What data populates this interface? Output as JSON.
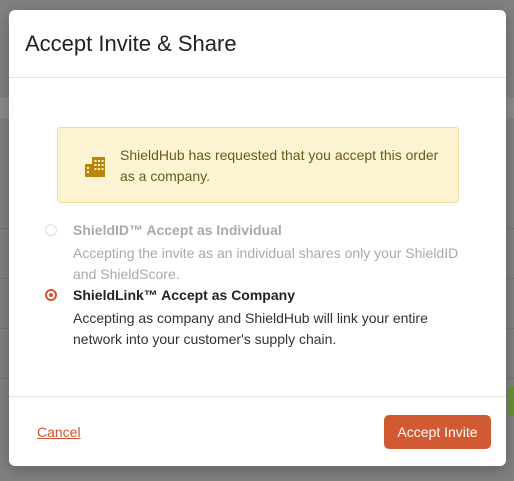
{
  "modal": {
    "title": "Accept Invite & Share",
    "notice": {
      "text": "ShieldHub has requested that you accept this order as a company.",
      "icon": "building-icon"
    },
    "options": [
      {
        "title": "ShieldID™ Accept as Individual",
        "description": "Accepting the invite as an individual shares only your ShieldID and ShieldScore.",
        "selected": false,
        "disabled": true
      },
      {
        "title": "ShieldLink™ Accept as Company",
        "description": "Accepting as company and ShieldHub will link your entire network into your customer's supply chain.",
        "selected": true,
        "disabled": false
      }
    ],
    "footer": {
      "cancel_label": "Cancel",
      "accept_label": "Accept Invite"
    }
  },
  "colors": {
    "accent": "#d25a33",
    "notice_bg": "#fcf3d2",
    "notice_text": "#6b5a1e",
    "icon": "#b8860b"
  }
}
